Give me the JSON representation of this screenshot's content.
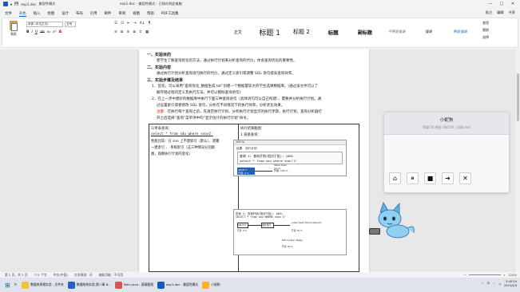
{
  "titlebar": {
    "tabs": [
      "exp1.doc",
      "兼容性模式"
    ],
    "title": "exp1.doc - 兼容性模式 - 已保存到此电脑",
    "controls": [
      "—",
      "□",
      "✕"
    ]
  },
  "menu": {
    "items": [
      "文件",
      "开始",
      "插入",
      "绘图",
      "设计",
      "布局",
      "引用",
      "邮件",
      "审阅",
      "视图",
      "帮助",
      "PDF工具集"
    ],
    "active": "开始",
    "right": [
      "批注",
      "编辑",
      "共享"
    ]
  },
  "ribbon": {
    "paste": "粘贴",
    "font": "宋体 (中文正文)",
    "size": "五号",
    "format_buttons": [
      "B",
      "I",
      "U",
      "ab",
      "x₂",
      "x²",
      "A"
    ],
    "para_buttons": [
      "☰",
      "☷",
      "⇤",
      "⇥",
      "A↓",
      "¶"
    ],
    "para_buttons2": [
      "≡",
      "≣",
      "≡",
      "≣",
      "↕",
      "▦"
    ],
    "styles": [
      {
        "label": "正文",
        "size": 5
      },
      {
        "label": "标题 1",
        "size": 9
      },
      {
        "label": "标题 2",
        "size": 7
      },
      {
        "label": "标题",
        "size": 7
      },
      {
        "label": "副标题",
        "size": 6
      },
      {
        "label": "不明显强调",
        "size": 4.3
      },
      {
        "label": "强调",
        "size": 4.3
      },
      {
        "label": "明显强调",
        "size": 4.3
      }
    ],
    "edit": [
      "查找",
      "替换",
      "选择"
    ]
  },
  "document": {
    "heading1": "一、实验目的",
    "line1": "使学生了解查询优化的方法，通过执行计划来分析查询的代价，体会查询优化的重要性。",
    "heading2": "二、实验内容",
    "line2": "通过执行计划分析查询语句执行的代价，通过定义索引或调整 SQL 语句提高查询效率。",
    "heading3": "三、实验步骤及结果",
    "step1a": "1．首先，可以采用“查询优化_数据生成.txt”创建一个数据量较大的学生选课数据库。(通过该文件可以了",
    "step1b": "解存储过程的定义及执行方法，并可以模拟查询语句)",
    "step2a": "2．在上一步中建好的数据库中执行下面三种查询语句（具体语句可以自己构建），需要并分析执行计划。通",
    "step2b": "过设置索引或者修改 SQL 语句，分析在不同情况下的执行效率，分析优化效果。",
    "note_label": "注意",
    "note_a": "：在执行每个查询之前，先清空执行计划，分析执行计划显示的执行步骤，执行计划，查询分析器打",
    "note_b": "开之后选择“查询”菜单项中的“显示估计的执行计划”命令。",
    "table": {
      "left_header": "1)单表查询：",
      "left_code": "select * from sdu where sno>2'",
      "left_desc1": "性能比较：在 sno 上不建索引（默认）、建聚",
      "left_desc2": "一建索引 、 系统索引（这三种情况分别跑",
      "left_desc3": "图，观察执行计划的变化）",
      "right_header": "执行结果截图：",
      "right_sub": "1.直接查询：",
      "right_sub2": "2.建立唯一索引："
    },
    "shot1": {
      "toolbar": "100 %",
      "tabs": [
        "结果",
        "执行计划"
      ],
      "query_line": "查询 1: 查询开销(相对于批): 100%",
      "sql_line": "select * from sou where sno='2'",
      "node1_title": "SELECT",
      "node1_cost": "开销: 0 %",
      "node2_title": "Table Scan",
      "node2_sub": "[sou]",
      "node2_cost": "开销: 100 %"
    },
    "shot2": {
      "query_line": "查询 1: 查询开销(相对于批): 100%",
      "sql_line": "SELECT * from sou WHERE sno='3'",
      "node1": "SELECT",
      "node2": "嵌套循环",
      "node3": "Index Seek (NonClustered)",
      "node4": "RID Lookup (Heap)",
      "cost_a": "开销: 0 %",
      "cost_b": "开销: 50 %",
      "cost_c": "开销: 50 %"
    }
  },
  "pet": {
    "name": "小妮狗",
    "status": "等级:50 经验:38/100 | 动画:rest",
    "buttons": [
      {
        "name": "home-icon",
        "glyph": "⌂"
      },
      {
        "name": "pause-icon",
        "glyph": "⏸"
      },
      {
        "name": "stop-icon",
        "glyph": "■"
      },
      {
        "name": "next-icon",
        "glyph": "➜"
      },
      {
        "name": "close-icon",
        "glyph": "✕"
      }
    ]
  },
  "statusbar": {
    "page": "第 2 页，共 2 页",
    "words": "771 个字",
    "lang": "中文(中国)",
    "ime": "文本预测：开",
    "access": "辅助功能：不可用",
    "zoom": "120%"
  },
  "taskbar": {
    "items": [
      {
        "label": "数据库原理实验 - 文件夹",
        "color": "#f2c230"
      },
      {
        "label": "数据结构实验-第八章 B...",
        "color": "#2b5dcd"
      },
      {
        "label": "Main.java - 屏幕截图",
        "color": "#d9534f"
      },
      {
        "label": "exp1.doc - 兼容性模式",
        "color": "#185abd"
      },
      {
        "label": "小妮狗",
        "color": "#ffb020"
      }
    ],
    "time": "3:40:54",
    "date": "2025/4/4",
    "lang": "中"
  }
}
